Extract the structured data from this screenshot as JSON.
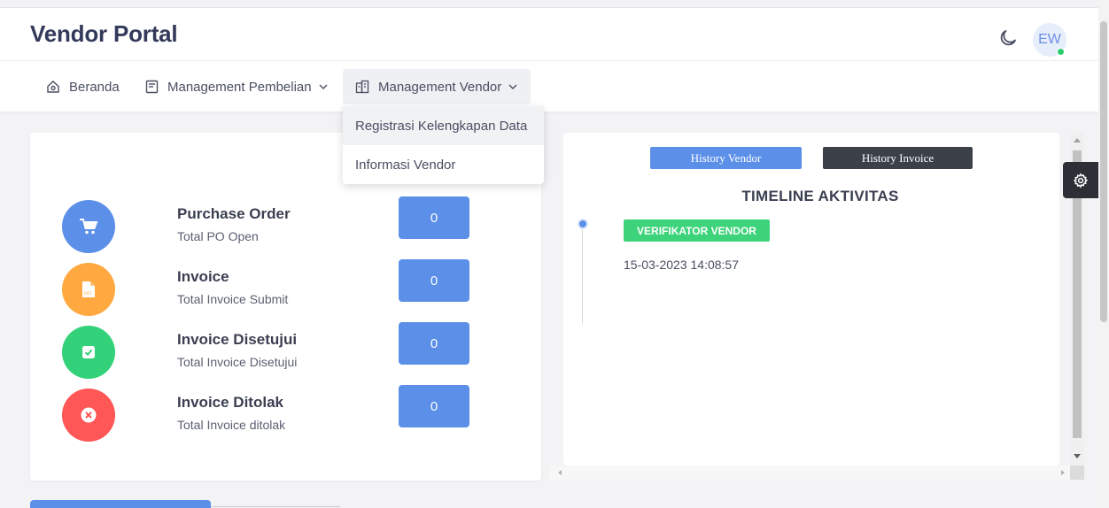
{
  "app": {
    "title": "Vendor Portal",
    "avatar_initials": "EW",
    "status_color": "#2ecc71"
  },
  "nav": {
    "items": [
      {
        "label": "Beranda",
        "icon": "home-icon"
      },
      {
        "label": "Management Pembelian",
        "icon": "document-icon"
      },
      {
        "label": "Management Vendor",
        "icon": "building-icon",
        "active": true
      }
    ],
    "dropdown": [
      "Registrasi Kelengkapan Data",
      "Informasi Vendor"
    ]
  },
  "stats": [
    {
      "title": "Purchase Order",
      "subtitle": "Total PO Open",
      "value": "0",
      "icon": "cart-icon",
      "color": "#5b8fe8"
    },
    {
      "title": "Invoice",
      "subtitle": "Total Invoice Submit",
      "value": "0",
      "icon": "document-icon",
      "color": "#ffa940"
    },
    {
      "title": "Invoice Disetujui",
      "subtitle": "Total Invoice Disetujui",
      "value": "0",
      "icon": "check-icon",
      "color": "#33d17a"
    },
    {
      "title": "Invoice Ditolak",
      "subtitle": "Total Invoice ditolak",
      "value": "0",
      "icon": "x-circle-icon",
      "color": "#ff5656"
    }
  ],
  "timeline": {
    "buttons": {
      "history_vendor": "History Vendor",
      "history_invoice": "History Invoice"
    },
    "title": "TIMELINE AKTIVITAS",
    "entries": [
      {
        "badge": "VERIFIKATOR VENDOR",
        "time": "15-03-2023 14:08:57"
      }
    ]
  },
  "colors": {
    "primary": "#5b8fe8",
    "dark": "#3c4149",
    "success": "#3dd37a"
  }
}
